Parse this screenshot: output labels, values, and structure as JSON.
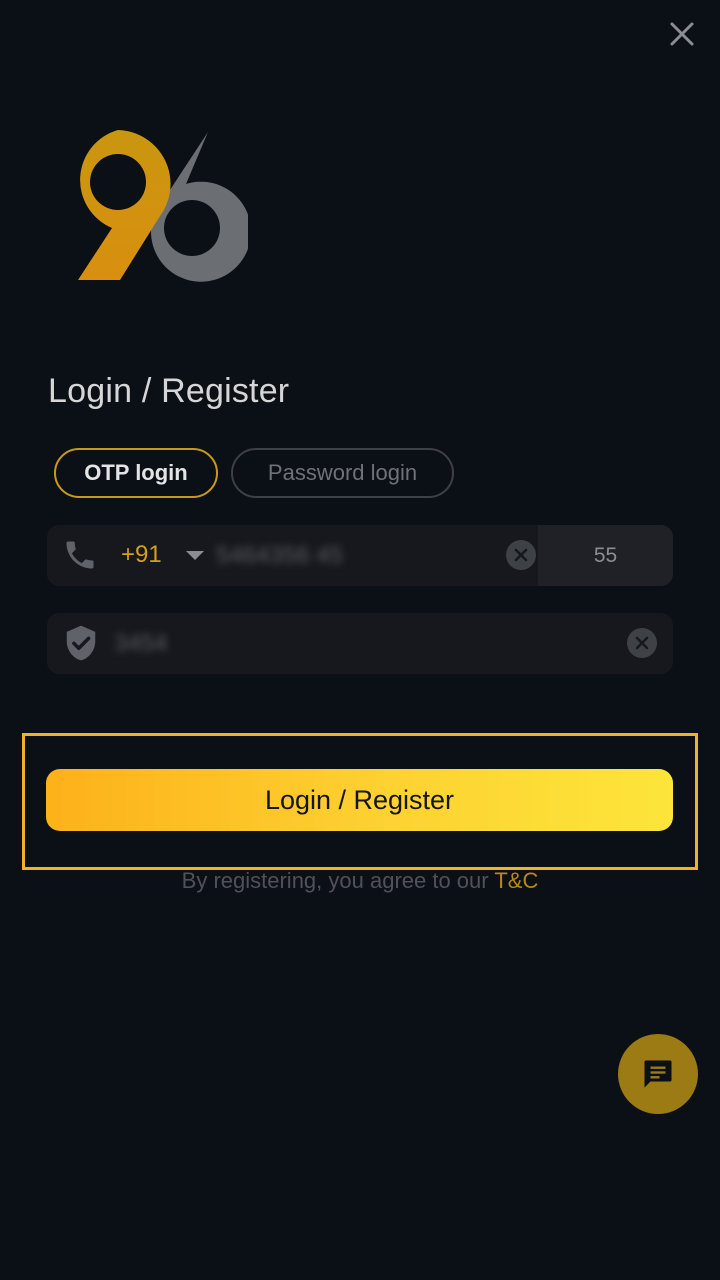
{
  "header": {
    "close_icon": "close-icon"
  },
  "logo": {
    "text": "96",
    "colors": {
      "nine": "#d4a015",
      "six": "#6b6e72"
    }
  },
  "title": "Login / Register",
  "tabs": [
    {
      "label": "OTP login",
      "active": true
    },
    {
      "label": "Password login",
      "active": false
    }
  ],
  "phone_field": {
    "icon": "phone-icon",
    "country_code": "+91",
    "value": "5464356 45",
    "clear_icon": "clear-icon",
    "timer": "55"
  },
  "code_field": {
    "icon": "shield-check-icon",
    "value": "3454",
    "clear_icon": "clear-icon"
  },
  "submit": {
    "label": "Login / Register"
  },
  "terms": {
    "text": "By registering, you agree to our ",
    "link": "T&C"
  },
  "chat": {
    "icon": "chat-icon"
  },
  "colors": {
    "accent": "#d4a015",
    "background": "#0b0f16",
    "highlight": "#f0b22a"
  }
}
